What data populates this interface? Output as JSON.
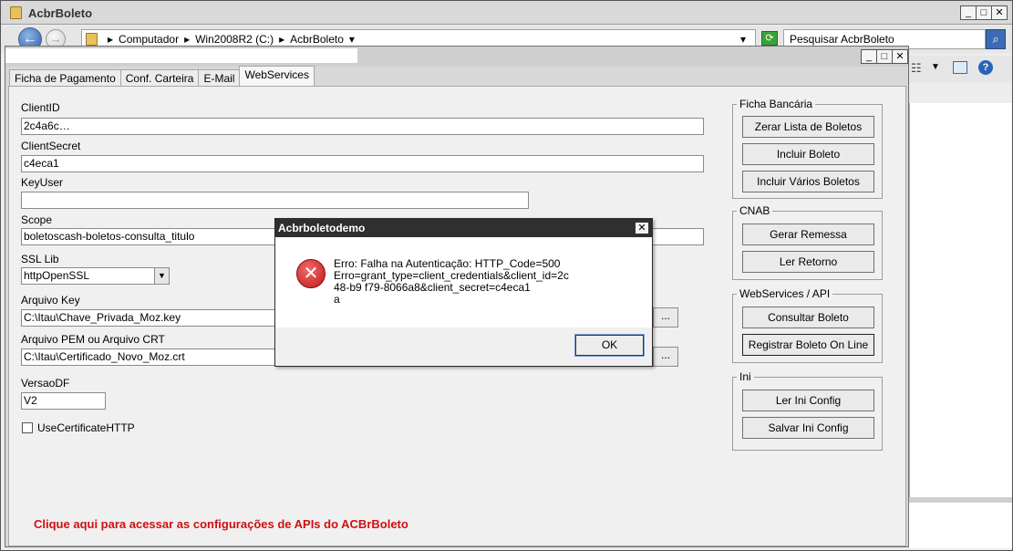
{
  "explorer": {
    "title": "AcbrBoleto",
    "breadcrumbs": [
      "Computador",
      "Win2008R2 (C:)",
      "AcbrBoleto"
    ],
    "search_placeholder": "Pesquisar AcbrBoleto",
    "window_controls": {
      "minimize": "_",
      "maximize": "□",
      "close": "✕"
    }
  },
  "app": {
    "window_controls": {
      "minimize": "_",
      "maximize": "□",
      "close": "✕"
    },
    "tabs": [
      {
        "label": "Ficha de Pagamento"
      },
      {
        "label": "Conf. Carteira"
      },
      {
        "label": "E-Mail"
      },
      {
        "label": "WebServices"
      }
    ],
    "form": {
      "client_id": {
        "label": "ClientID",
        "value": "2c4a6c…"
      },
      "client_secret": {
        "label": "ClientSecret",
        "value": "c4eca1"
      },
      "key_user": {
        "label": "KeyUser",
        "value": ""
      },
      "scope": {
        "label": "Scope",
        "value": "boletoscash-boletos-consulta_titulo"
      },
      "ssl_lib": {
        "label": "SSL Lib",
        "value": "httpOpenSSL"
      },
      "arquivo_key": {
        "label": "Arquivo Key",
        "value": "C:\\Itau\\Chave_Privada_Moz.key"
      },
      "arquivo_pem": {
        "label": "Arquivo PEM ou Arquivo CRT",
        "value": "C:\\Itau\\Certificado_Novo_Moz.crt"
      },
      "versao_df": {
        "label": "VersaoDF",
        "value": "V2"
      },
      "use_cert_http": {
        "label": "UseCertificateHTTP",
        "checked": false
      },
      "browse_label": "..."
    },
    "link_text": "Clique aqui para acessar as configurações de APIs do ACBrBoleto",
    "groups": {
      "ficha": {
        "title": "Ficha Bancária",
        "buttons": [
          "Zerar Lista de Boletos",
          "Incluir Boleto",
          "Incluir Vários Boletos"
        ]
      },
      "cnab": {
        "title": "CNAB",
        "buttons": [
          "Gerar Remessa",
          "Ler Retorno"
        ]
      },
      "ws": {
        "title": "WebServices / API",
        "buttons": [
          "Consultar Boleto",
          "Registrar Boleto On Line"
        ]
      },
      "ini": {
        "title": "Ini",
        "buttons": [
          "Ler Ini Config",
          "Salvar Ini Config"
        ]
      }
    }
  },
  "dialog": {
    "title": "Acbrboletodemo",
    "close_label": "✕",
    "icon": "error-icon",
    "message_lines": [
      "Erro: Falha na Autenticação: HTTP_Code=500",
      "Erro=grant_type=client_credentials&client_id=2c",
      "48-b9    f79-8066a8&client_secret=c4eca1",
      "a"
    ],
    "ok_label": "OK"
  }
}
